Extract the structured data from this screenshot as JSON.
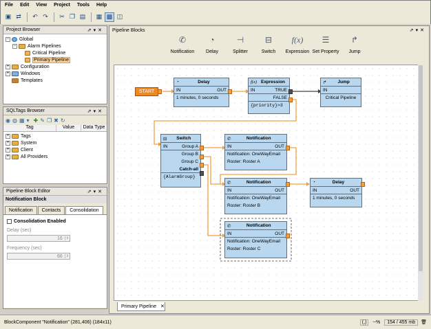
{
  "menu": [
    "File",
    "Edit",
    "View",
    "Project",
    "Tools",
    "Help"
  ],
  "project_browser": {
    "title": "Project Browser",
    "items": [
      "Global",
      "Alarm Pipelines",
      "Critical Pipeline",
      "Primary Pipeline",
      "Configuration",
      "Windows",
      "Templates"
    ]
  },
  "sqltags": {
    "title": "SQLTags Browser",
    "columns": [
      "Tag",
      "Value",
      "Data Type"
    ],
    "items": [
      "Tags",
      "System",
      "Client",
      "All Providers"
    ]
  },
  "editor": {
    "title": "Pipeline Block Editor",
    "subtitle": "Notification Block",
    "tabs": [
      "Notification",
      "Contacts",
      "Consolidation"
    ],
    "consolidation_label": "Consolidation Enabled",
    "delay_label": "Delay (sec)",
    "delay_value": "16",
    "frequency_label": "Frequency (sec)",
    "frequency_value": "66"
  },
  "pipeline_blocks": {
    "title": "Pipeline Blocks",
    "palette": [
      {
        "label": "Notification",
        "icon": "phone-icon"
      },
      {
        "label": "Delay",
        "icon": "clock-icon"
      },
      {
        "label": "Splitter",
        "icon": "splitter-icon"
      },
      {
        "label": "Switch",
        "icon": "switch-icon"
      },
      {
        "label": "Expression",
        "icon": "function-icon"
      },
      {
        "label": "Set Property",
        "icon": "list-icon"
      },
      {
        "label": "Jump",
        "icon": "jump-icon"
      }
    ]
  },
  "canvas": {
    "start": "START",
    "delay1": {
      "title": "Delay",
      "in": "IN",
      "out": "OUT",
      "body": "1 minutes, 0 seconds"
    },
    "expression": {
      "title": "Expression",
      "in": "IN",
      "true": "TRUE",
      "false": "FALSE",
      "body": "{priority}>3"
    },
    "jump": {
      "title": "Jump",
      "in": "IN",
      "body": "Critical Pipeline"
    },
    "switch": {
      "title": "Switch",
      "in": "IN",
      "groups": [
        "Group A",
        "Group B",
        "Group C",
        "Catch-all"
      ],
      "body": "{AlarmGroup}"
    },
    "notif1": {
      "title": "Notification",
      "in": "IN",
      "out": "OUT",
      "notification": "Notification: OneWayEmail",
      "roster": "Roster: Roster A"
    },
    "notif2": {
      "title": "Notification",
      "in": "IN",
      "out": "OUT",
      "notification": "Notification: OneWayEmail",
      "roster": "Roster: Roster B"
    },
    "notif3": {
      "title": "Notification",
      "in": "IN",
      "out": "OUT",
      "notification": "Notification: OneWayEmail",
      "roster": "Roster: Roster C"
    },
    "delay2": {
      "title": "Delay",
      "in": "IN",
      "out": "OUT",
      "body": "1 minutes, 0 seconds"
    }
  },
  "doc_tab": "Primary Pipeline",
  "status": {
    "left": "BlockComponent \"Notification\" (281,406) (184x11)",
    "zoom": "--%",
    "memory": "154 / 455 mb"
  }
}
